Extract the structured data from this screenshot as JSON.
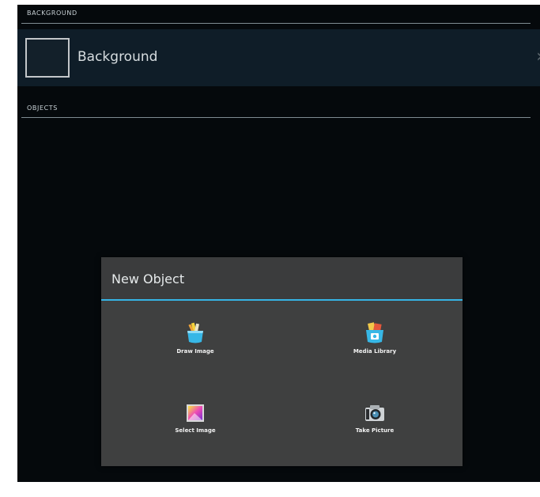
{
  "sections": {
    "background_header": "BACKGROUND",
    "objects_header": "OBJECTS"
  },
  "background_item": {
    "label": "Background",
    "chevron": "chevron-right-icon"
  },
  "dialog": {
    "title": "New Object",
    "options": [
      {
        "label": "Draw Image",
        "icon": "draw-image-icon"
      },
      {
        "label": "Media Library",
        "icon": "media-library-icon"
      },
      {
        "label": "Select Image",
        "icon": "select-image-icon"
      },
      {
        "label": "Take Picture",
        "icon": "camera-icon"
      }
    ]
  },
  "colors": {
    "screen_bg": "#05090c",
    "row_bg": "#0f1d28",
    "dialog_bg": "#3b3c3d",
    "accent": "#36b4e5"
  }
}
